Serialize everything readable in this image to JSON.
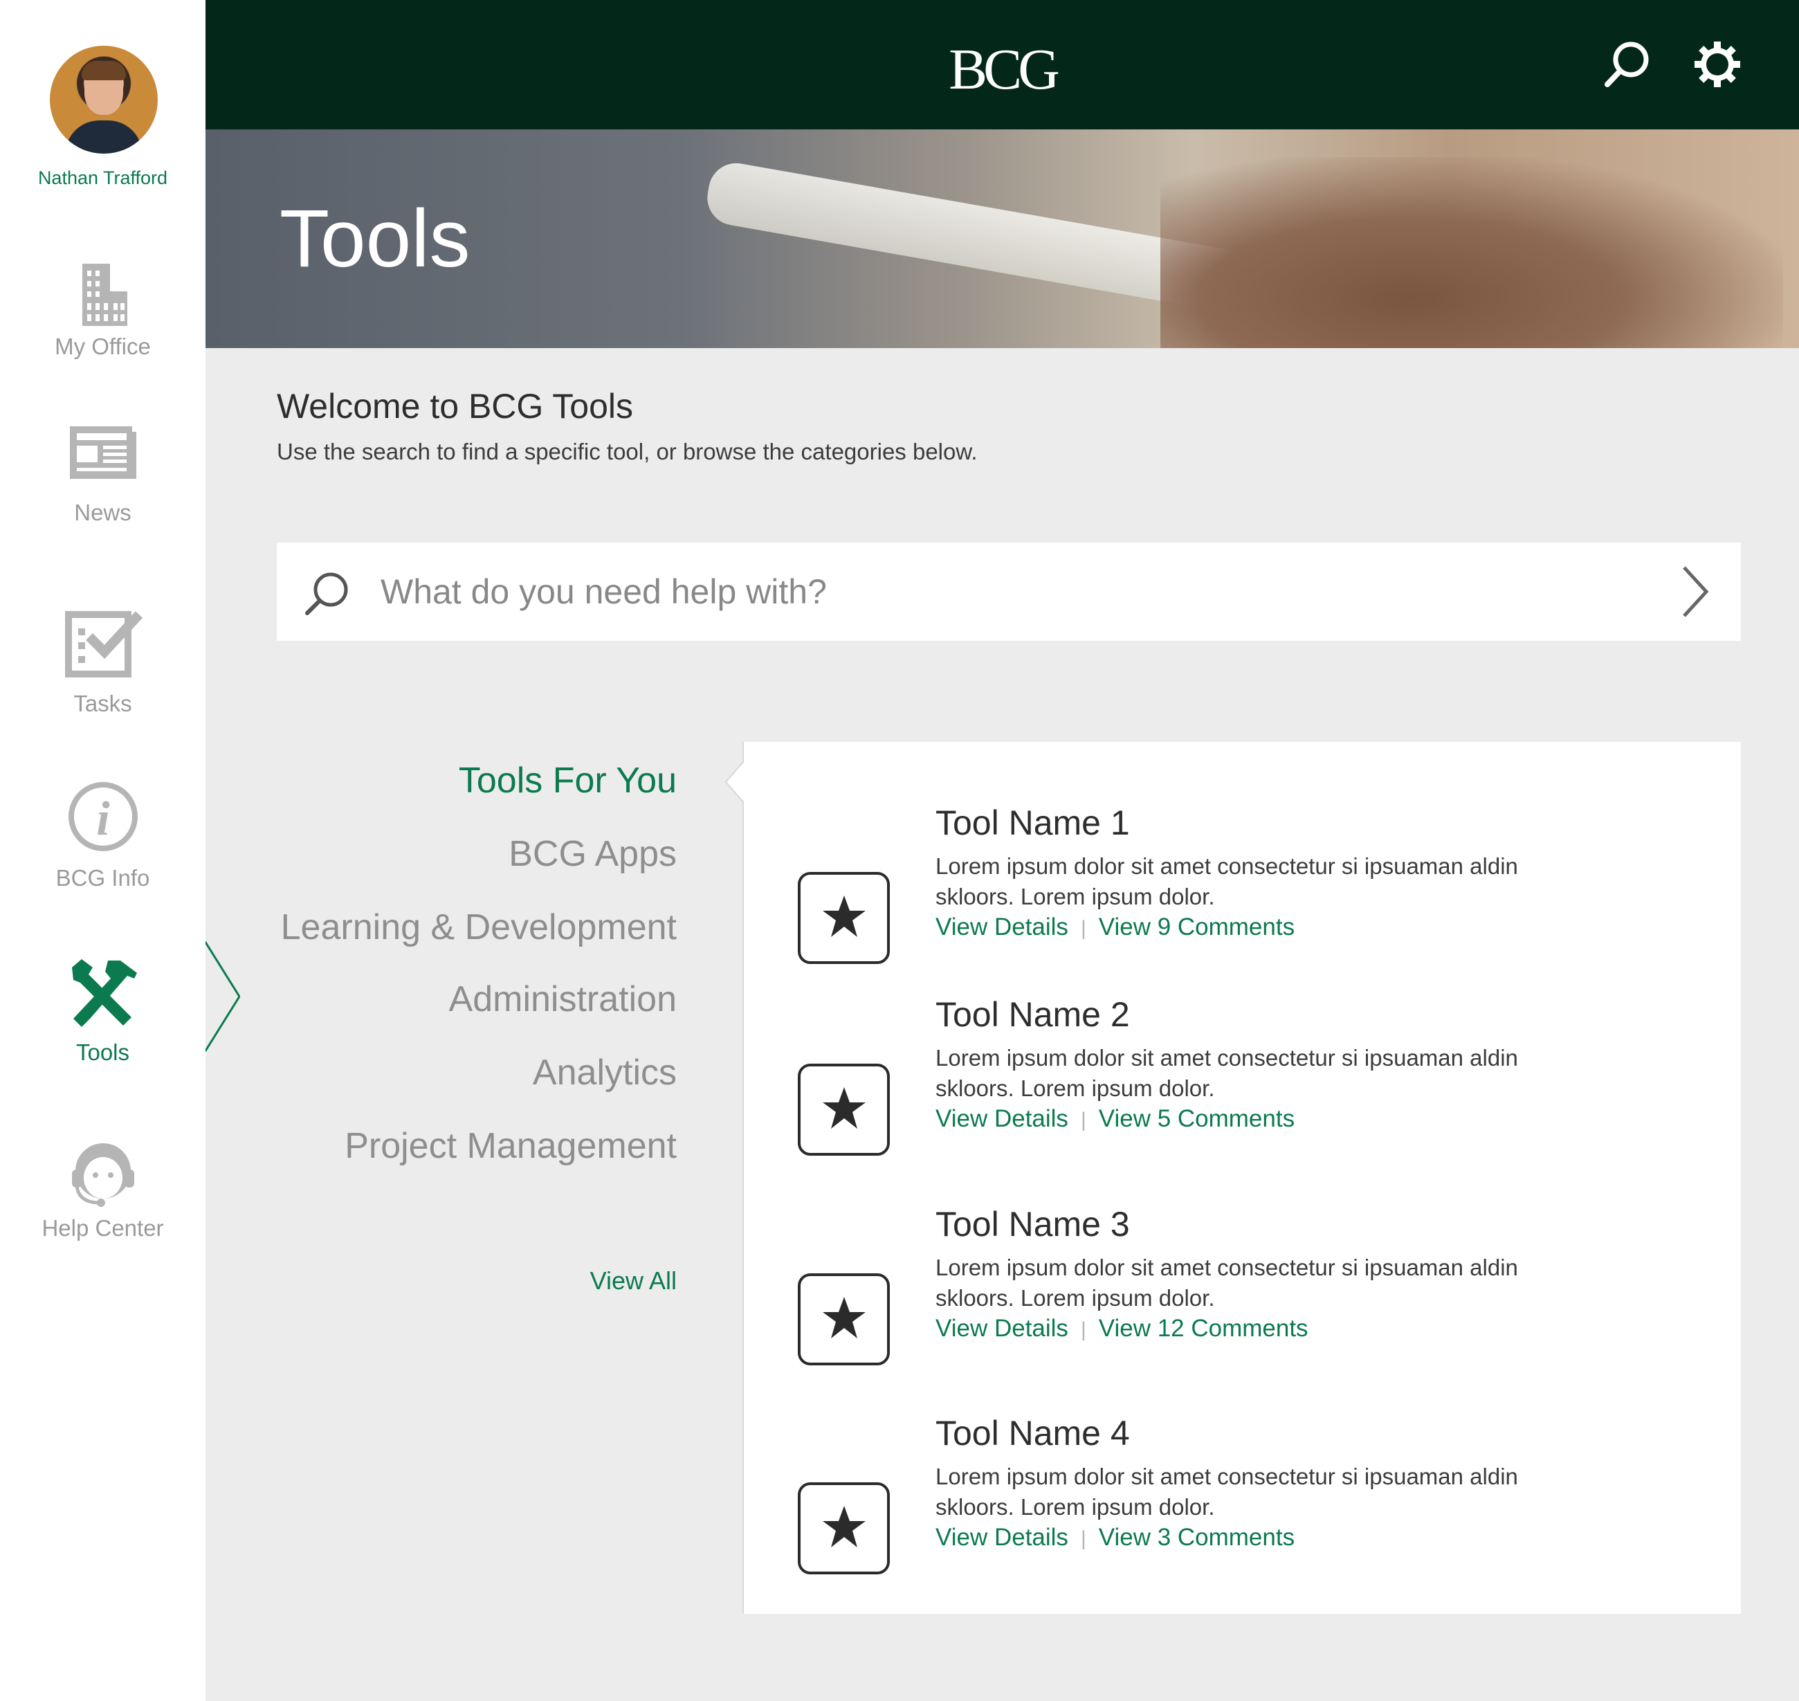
{
  "user": {
    "name": "Nathan Trafford"
  },
  "sidebar": {
    "items": [
      {
        "label": "My Office",
        "icon": "building-icon",
        "active": false
      },
      {
        "label": "News",
        "icon": "newspaper-icon",
        "active": false
      },
      {
        "label": "Tasks",
        "icon": "checklist-icon",
        "active": false
      },
      {
        "label": "BCG Info",
        "icon": "info-icon",
        "active": false
      },
      {
        "label": "Tools",
        "icon": "tools-icon",
        "active": true
      },
      {
        "label": "Help Center",
        "icon": "support-agent-icon",
        "active": false
      }
    ]
  },
  "header": {
    "logo": "BCG",
    "icons": [
      "search-icon",
      "gear-icon"
    ]
  },
  "hero": {
    "title": "Tools"
  },
  "welcome": {
    "title": "Welcome to BCG Tools",
    "subtitle": "Use the search to find a specific tool, or browse the categories below."
  },
  "search": {
    "placeholder": "What do you need help with?",
    "value": ""
  },
  "categories": {
    "items": [
      {
        "label": "Tools For You",
        "active": true
      },
      {
        "label": "BCG Apps",
        "active": false
      },
      {
        "label": "Learning & Development",
        "active": false
      },
      {
        "label": "Administration",
        "active": false
      },
      {
        "label": "Analytics",
        "active": false
      },
      {
        "label": "Project Management",
        "active": false
      }
    ],
    "view_all": "View All"
  },
  "tools": [
    {
      "name": "Tool Name 1",
      "description": "Lorem ipsum dolor sit amet consectetur si ipsuaman aldin skloors. Lorem ipsum dolor.",
      "details_label": "View Details",
      "comments_label": "View 9 Comments"
    },
    {
      "name": "Tool Name 2",
      "description": "Lorem ipsum dolor sit amet consectetur si ipsuaman aldin skloors. Lorem ipsum dolor.",
      "details_label": "View Details",
      "comments_label": "View 5 Comments"
    },
    {
      "name": "Tool Name 3",
      "description": "Lorem ipsum dolor sit amet consectetur si ipsuaman aldin skloors. Lorem ipsum dolor.",
      "details_label": "View Details",
      "comments_label": "View 12 Comments"
    },
    {
      "name": "Tool Name 4",
      "description": "Lorem ipsum dolor sit amet consectetur si ipsuaman aldin skloors. Lorem ipsum dolor.",
      "details_label": "View Details",
      "comments_label": "View 3 Comments"
    }
  ],
  "colors": {
    "brand_dark": "#03281a",
    "accent_green": "#0b7a4e",
    "muted_gray": "#9a9a9a",
    "background": "#ececec"
  }
}
